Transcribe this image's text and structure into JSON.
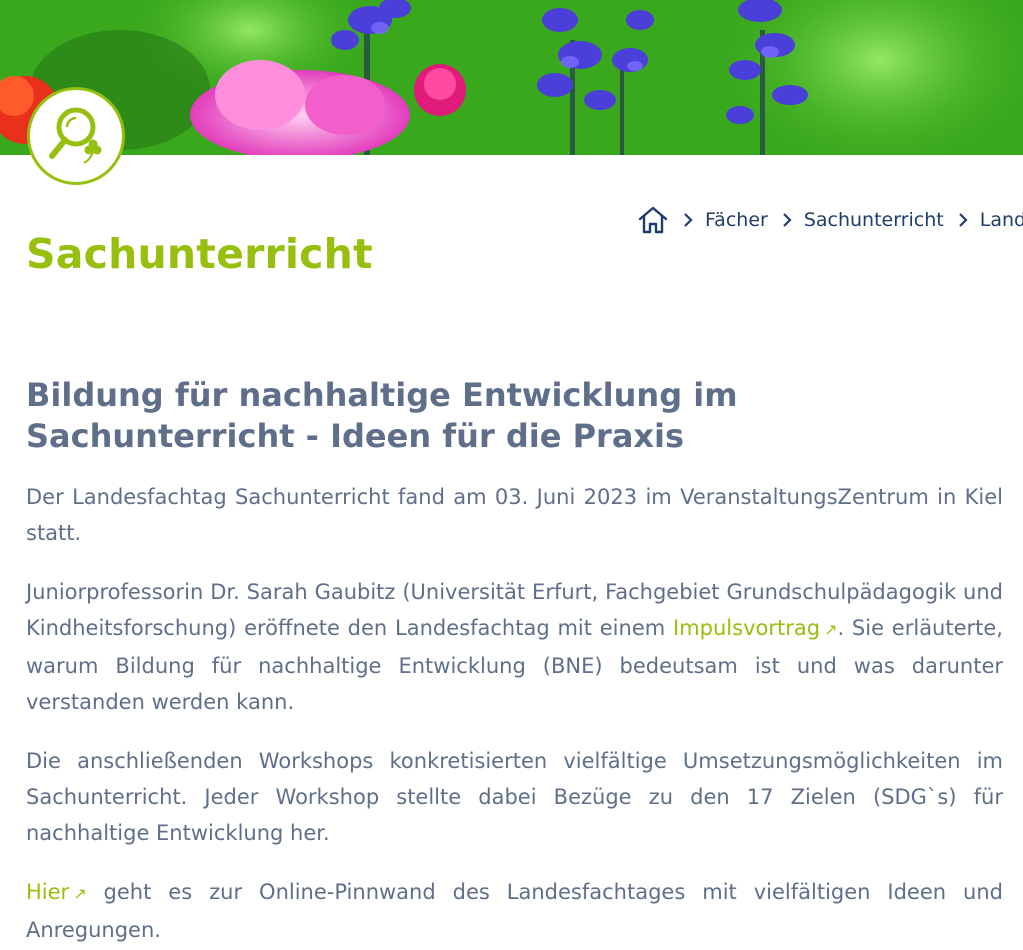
{
  "hero": {
    "icon": "flower-meadow-image"
  },
  "badge": {
    "icon": "magnifier-leaf-icon",
    "accent_color": "#97bf0d"
  },
  "breadcrumb": {
    "home_icon": "home-icon",
    "separator_icon": "chevron-right-icon",
    "items": [
      "Fächer",
      "Sachunterricht",
      "Landesfachtag"
    ]
  },
  "page": {
    "title": "Sachunterricht"
  },
  "article": {
    "heading": "Bildung für nachhaltige Entwicklung im Sachunterricht - Ideen für die Praxis",
    "p1": "Der Landesfachtag Sachunterricht fand am 03. Juni 2023 im VeranstaltungsZentrum in Kiel statt.",
    "p2_before": "Juniorprofessorin Dr. Sarah Gaubitz (Universität Erfurt, Fachgebiet Grundschulpädagogik und Kindheitsforschung) eröffnete den Landesfachtag mit einem ",
    "p2_link": "Impulsvortrag",
    "p2_after": ". Sie erläuterte, warum Bildung für nachhaltige Entwicklung (BNE) bedeutsam ist und was darunter verstanden werden kann.",
    "p3": "Die anschließenden Workshops konkretisierten vielfältige Umsetzungsmöglichkeiten im Sachunterricht. Jeder Workshop stellte dabei Bezüge zu den 17 Zielen (SDG`s) für nachhaltige Entwicklung her.",
    "p4_link": "Hier",
    "p4_after": " geht es zur Online-Pinnwand des Landesfachtages mit vielfältigen Ideen und Anregungen.",
    "external_link_glyph": "↗"
  },
  "colors": {
    "accent_green": "#97bf0d",
    "text_gray_blue": "#5f6f8a",
    "breadcrumb_navy": "#1d3d6b"
  }
}
